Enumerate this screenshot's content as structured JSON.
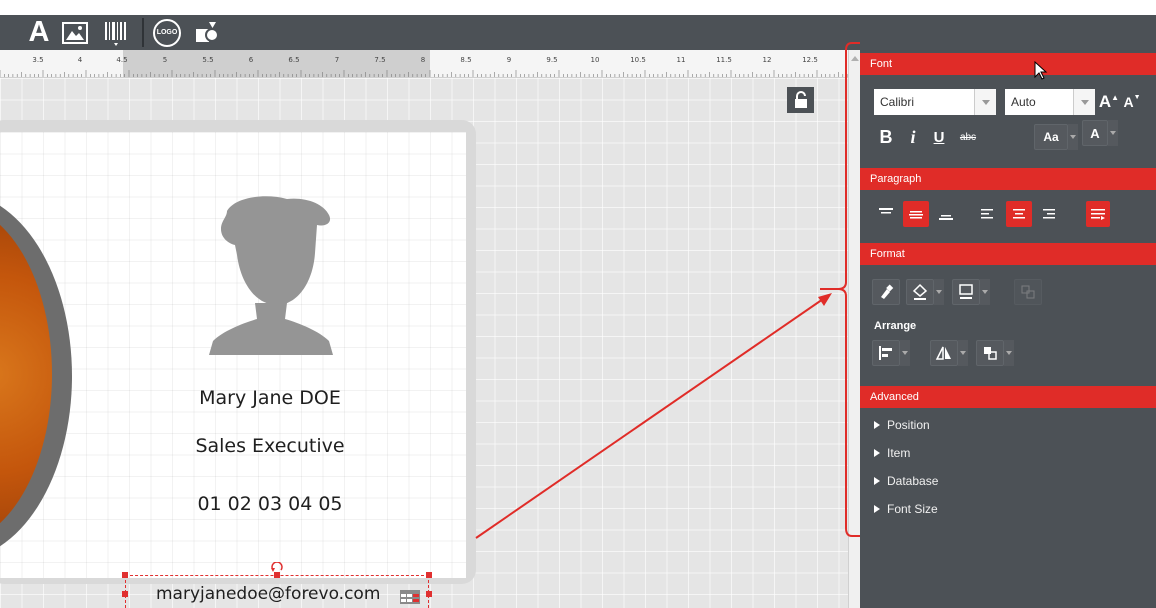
{
  "colors": {
    "accent": "#e02c28",
    "panel": "#4c5156",
    "canvas": "#e5e5e5"
  },
  "toolbar": {
    "tools": [
      {
        "id": "text",
        "label": "A",
        "icon": "text-tool-icon"
      },
      {
        "id": "image",
        "icon": "image-tool-icon"
      },
      {
        "id": "barcode",
        "icon": "barcode-tool-icon"
      },
      {
        "id": "logo",
        "label": "LOGO",
        "icon": "logo-tool-icon"
      },
      {
        "id": "shapes",
        "icon": "shapes-tool-icon"
      }
    ]
  },
  "ruler": {
    "labels": [
      "3.5",
      "4",
      "4.5",
      "5",
      "5.5",
      "6",
      "6.5",
      "7",
      "7.5",
      "8",
      "8.5",
      "9",
      "9.5",
      "10",
      "10.5",
      "11",
      "11.5",
      "12",
      "12.5"
    ]
  },
  "card": {
    "name": "Mary Jane DOE",
    "job_title": "Sales Executive",
    "phone": "01 02 03 04 05",
    "email": "maryjanedoe@forevo.com"
  },
  "panel": {
    "font": {
      "header": "Font",
      "family": "Calibri",
      "size": "Auto",
      "grow_label": "A",
      "shrink_label": "A",
      "bold": "B",
      "italic": "i",
      "underline": "U",
      "strike": "abc",
      "case_label": "Aa",
      "color_label": "A"
    },
    "paragraph": {
      "header": "Paragraph"
    },
    "format": {
      "header": "Format",
      "arrange_label": "Arrange"
    },
    "advanced": {
      "header": "Advanced",
      "items": [
        "Position",
        "Item",
        "Database",
        "Font Size"
      ]
    }
  }
}
